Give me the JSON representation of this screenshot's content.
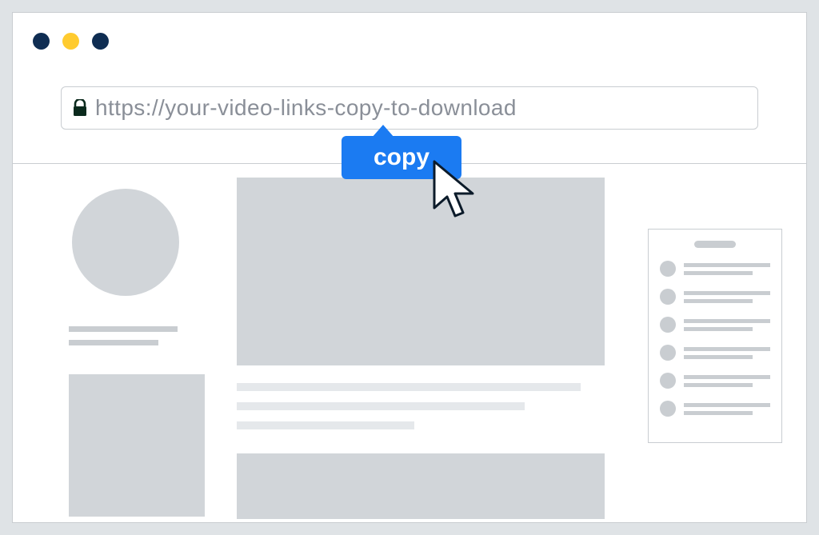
{
  "addressbar": {
    "url": "https://your-video-links-copy-to-download"
  },
  "tooltip": {
    "label": "copy"
  }
}
